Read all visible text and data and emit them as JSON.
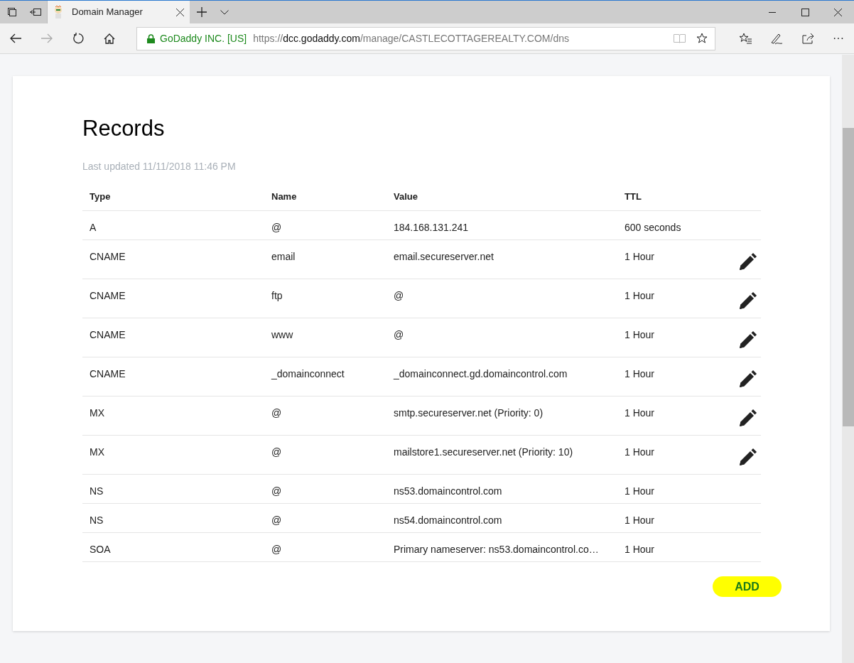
{
  "browser": {
    "tab": {
      "title": "Domain Manager",
      "selected": true
    },
    "address_bar": {
      "site_identity": "GoDaddy INC. [US]",
      "url_scheme": "https://",
      "url_host": "dcc.godaddy.com",
      "url_path": "/manage/CASTLECOTTAGEREALTY.COM/dns"
    },
    "more_button": "···"
  },
  "page": {
    "title": "Records",
    "last_updated": "Last updated 11/11/2018 11:46 PM",
    "table": {
      "columns": [
        "Type",
        "Name",
        "Value",
        "TTL"
      ],
      "rows": [
        {
          "type": "A",
          "name": "@",
          "value": "184.168.131.241",
          "ttl": "600 seconds",
          "editable": false
        },
        {
          "type": "CNAME",
          "name": "email",
          "value": "email.secureserver.net",
          "ttl": "1 Hour",
          "editable": true
        },
        {
          "type": "CNAME",
          "name": "ftp",
          "value": "@",
          "ttl": "1 Hour",
          "editable": true
        },
        {
          "type": "CNAME",
          "name": "www",
          "value": "@",
          "ttl": "1 Hour",
          "editable": true
        },
        {
          "type": "CNAME",
          "name": "_domainconnect",
          "value": "_domainconnect.gd.domaincontrol.com",
          "ttl": "1 Hour",
          "editable": true
        },
        {
          "type": "MX",
          "name": "@",
          "value": "smtp.secureserver.net (Priority: 0)",
          "ttl": "1 Hour",
          "editable": true
        },
        {
          "type": "MX",
          "name": "@",
          "value": "mailstore1.secureserver.net (Priority: 10)",
          "ttl": "1 Hour",
          "editable": true
        },
        {
          "type": "NS",
          "name": "@",
          "value": "ns53.domaincontrol.com",
          "ttl": "1 Hour",
          "editable": false
        },
        {
          "type": "NS",
          "name": "@",
          "value": "ns54.domaincontrol.com",
          "ttl": "1 Hour",
          "editable": false
        },
        {
          "type": "SOA",
          "name": "@",
          "value": "Primary nameserver: ns53.domaincontrol.co…",
          "ttl": "1 Hour",
          "editable": false
        }
      ]
    },
    "add_button": "ADD"
  }
}
